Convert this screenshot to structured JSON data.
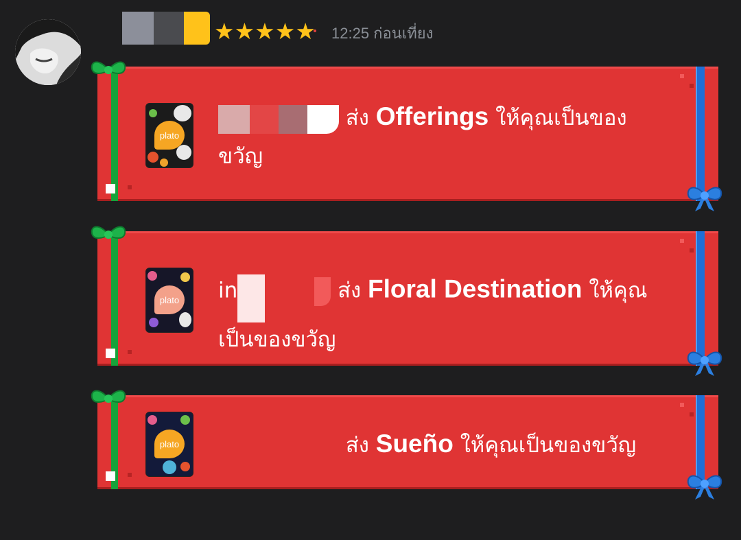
{
  "header": {
    "name_redaction_colors": [
      "#8c8f9a",
      "#4a4b4f",
      "#ffc21a"
    ],
    "rating_stars": "★★★★★",
    "rating": 5,
    "timestamp": "12:25 ก่อนเที่ยง"
  },
  "gifts": [
    {
      "title": "Offerings",
      "sends": "ส่ง",
      "suffix_line1": "ให้คุณเป็นของ",
      "suffix_line2": "ขวัญ",
      "card_brand": "plato",
      "card_colors": {
        "bg": "#1b1b1b",
        "blob": "#f6a623",
        "accent": "#e8e8e8"
      }
    },
    {
      "title": "Floral Destination",
      "sends": "ส่ง",
      "sender_visible": "in",
      "suffix_line1": "ให้คุณ",
      "suffix_line2": "เป็นของขวัญ",
      "card_brand": "plato",
      "card_colors": {
        "bg": "#161628",
        "blob": "#f3a18a",
        "accent": "#e45d8c"
      }
    },
    {
      "title": "Sueño",
      "sends": "ส่ง",
      "suffix_line1": "ให้คุณเป็นของขวัญ",
      "card_brand": "plato",
      "card_colors": {
        "bg": "#131a3a",
        "blob": "#f6a623",
        "accent": "#4fb3d9"
      }
    }
  ]
}
